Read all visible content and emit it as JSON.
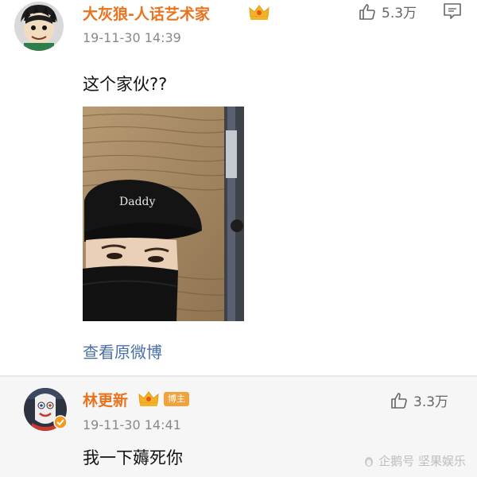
{
  "comment1": {
    "username": "大灰狼-人话艺术家",
    "timestamp": "19-11-30 14:39",
    "likes": "5.3万",
    "text": "这个家伙??",
    "photo_cap_text": "Daddy",
    "link_label": "查看原微博",
    "icons": [
      "avatar",
      "crown-icon",
      "thumbs-up-icon",
      "comment-icon"
    ]
  },
  "comment2": {
    "username": "林更新",
    "badge": "博主",
    "timestamp": "19-11-30 14:41",
    "likes": "3.3万",
    "text": "我一下薅死你",
    "icons": [
      "avatar",
      "crown-icon",
      "thumbs-up-icon",
      "verified-icon"
    ]
  },
  "watermark": "企鹅号 坚果娱乐",
  "colors": {
    "username": "#e8731e",
    "link": "#4a6fa8",
    "timestamp": "#888888",
    "badge": "#f2a23c",
    "second_bg": "#f6f6f6"
  }
}
